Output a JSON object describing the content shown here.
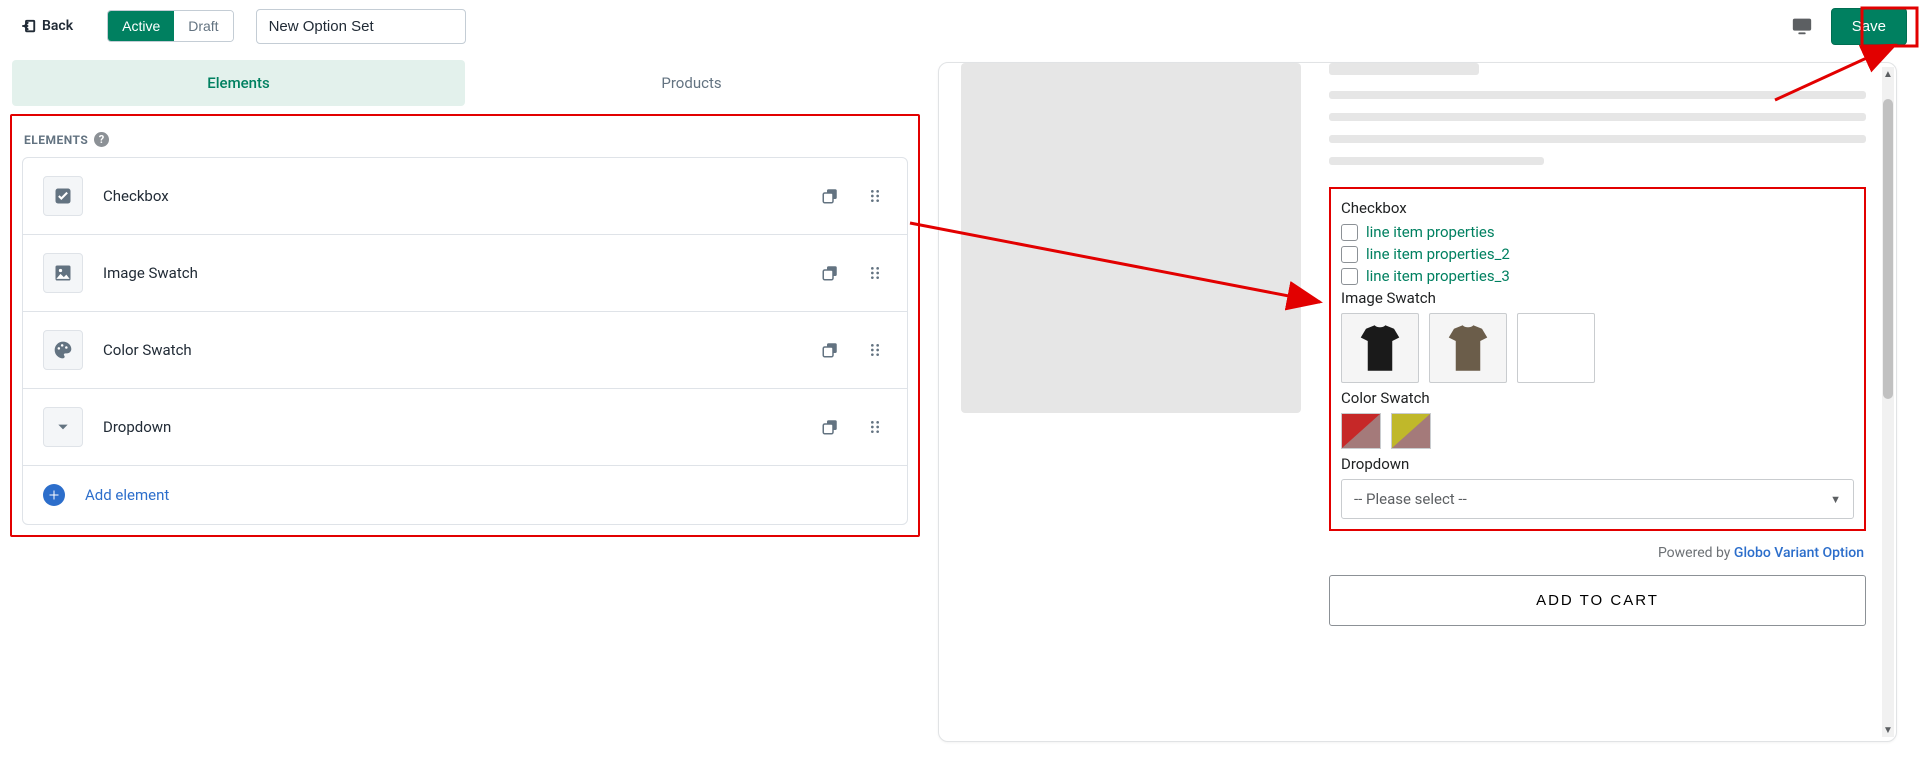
{
  "topbar": {
    "back_label": "Back",
    "active_label": "Active",
    "draft_label": "Draft",
    "name_value": "New Option Set",
    "save_label": "Save"
  },
  "tabs": {
    "elements": "Elements",
    "products": "Products"
  },
  "elements_panel": {
    "title": "ELEMENTS",
    "items": [
      {
        "name": "Checkbox",
        "icon": "checkbox"
      },
      {
        "name": "Image Swatch",
        "icon": "image"
      },
      {
        "name": "Color Swatch",
        "icon": "palette"
      },
      {
        "name": "Dropdown",
        "icon": "caret"
      }
    ],
    "add_label": "Add element"
  },
  "preview": {
    "checkbox": {
      "label": "Checkbox",
      "options": [
        "line item properties",
        "line item properties_2",
        "line item properties_3"
      ]
    },
    "image_swatch": {
      "label": "Image Swatch"
    },
    "color_swatch": {
      "label": "Color Swatch",
      "colors": [
        {
          "a": "#c62828",
          "b": "#a47a7a"
        },
        {
          "a": "#c0b82a",
          "b": "#a47a7a"
        }
      ]
    },
    "dropdown": {
      "label": "Dropdown",
      "placeholder": "-- Please select --"
    },
    "powered_prefix": "Powered by ",
    "powered_link": "Globo Variant Option",
    "add_to_cart": "ADD TO CART"
  }
}
